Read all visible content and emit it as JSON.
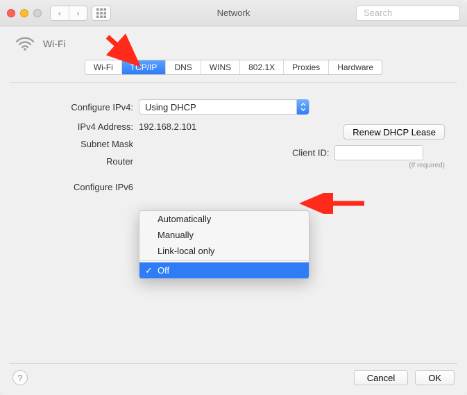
{
  "window": {
    "title": "Network",
    "search_placeholder": "Search"
  },
  "service": {
    "name": "Wi-Fi"
  },
  "tabs": [
    {
      "label": "Wi-Fi"
    },
    {
      "label": "TCP/IP"
    },
    {
      "label": "DNS"
    },
    {
      "label": "WINS"
    },
    {
      "label": "802.1X"
    },
    {
      "label": "Proxies"
    },
    {
      "label": "Hardware"
    }
  ],
  "form": {
    "configure_ipv4_label": "Configure IPv4:",
    "configure_ipv4_value": "Using DHCP",
    "ipv4_addr_label": "IPv4 Address:",
    "ipv4_addr_value": "192.168.2.101",
    "subnet_label": "Subnet Mask",
    "router_label": "Router",
    "configure_ipv6_label": "Configure IPv6",
    "renew_label": "Renew DHCP Lease",
    "clientid_label": "Client ID:",
    "clientid_hint": "(If required)"
  },
  "ipv6_menu": {
    "options": [
      "Automatically",
      "Manually",
      "Link-local only"
    ],
    "selected": "Off"
  },
  "footer": {
    "cancel": "Cancel",
    "ok": "OK"
  }
}
